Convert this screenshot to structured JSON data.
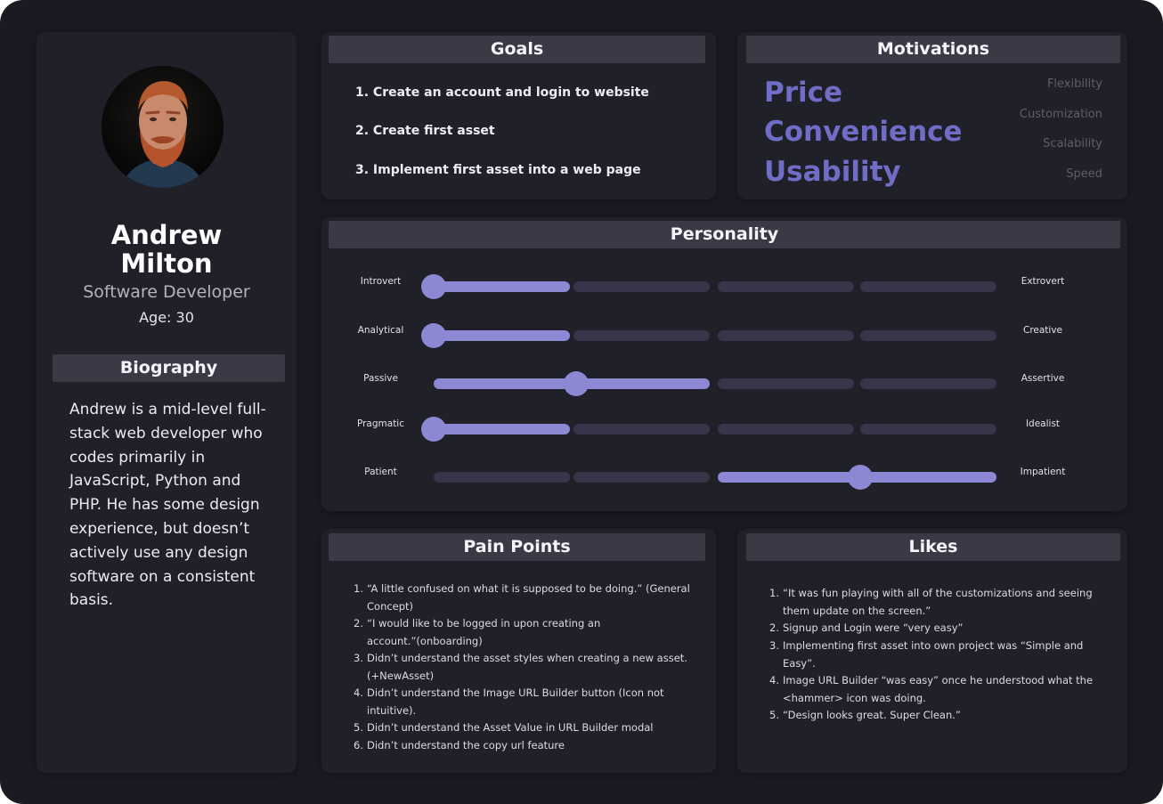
{
  "profile": {
    "name": "Andrew Milton",
    "role": "Software Developer",
    "age": "Age: 30",
    "avatar_icon": "person-portrait-icon"
  },
  "biography": {
    "title": "Biography",
    "text": "Andrew is a mid-level full-stack web developer who codes primarily in JavaScript, Python and PHP. He has some design experience, but doesn’t actively use any design software on a consistent basis."
  },
  "goals": {
    "title": "Goals",
    "items": [
      "1. Create an account and login to website",
      "2. Create first asset",
      "3. Implement first asset into a web page"
    ]
  },
  "motivations": {
    "title": "Motivations",
    "primary": [
      "Price",
      "Convenience",
      "Usability"
    ],
    "secondary": [
      "Flexibility",
      "Customization",
      "Scalability",
      "Speed"
    ]
  },
  "personality": {
    "title": "Personality",
    "traits": [
      {
        "left": "Introvert",
        "right": "Extrovert",
        "level": 0.0
      },
      {
        "left": "Analytical",
        "right": "Creative",
        "level": 0.0
      },
      {
        "left": "Passive",
        "right": "Assertive",
        "level": 0.25
      },
      {
        "left": "Pragmatic",
        "right": "Idealist",
        "level": 0.0
      },
      {
        "left": "Patient",
        "right": "Impatient",
        "level": 0.75
      }
    ]
  },
  "pain_points": {
    "title": "Pain Points",
    "items": [
      {
        "n": "1.",
        "lines": [
          "“A little confused on what it is supposed to be doing.” (General",
          "Concept)"
        ]
      },
      {
        "n": "2.",
        "lines": [
          "“I would like to be logged in upon creating an",
          "account.”(onboarding)"
        ]
      },
      {
        "n": "3.",
        "lines": [
          "Didn’t understand the asset styles when creating a new asset.",
          "(+NewAsset)"
        ]
      },
      {
        "n": "4.",
        "lines": [
          "Didn’t understand the Image URL Builder button (Icon not",
          "intuitive)."
        ]
      },
      {
        "n": "5.",
        "lines": [
          "Didn’t understand the Asset Value in URL Builder modal"
        ]
      },
      {
        "n": "6.",
        "lines": [
          "Didn’t understand the copy url feature"
        ]
      }
    ]
  },
  "likes": {
    "title": "Likes",
    "items": [
      {
        "n": "1.",
        "lines": [
          "“It was fun playing with all of the customizations and seeing",
          "them update on the screen.”"
        ]
      },
      {
        "n": "2.",
        "lines": [
          "Signup and Login were “very easy”"
        ]
      },
      {
        "n": "3.",
        "lines": [
          "Implementing first asset into own project was “Simple and",
          "Easy”."
        ]
      },
      {
        "n": "4.",
        "lines": [
          "Image URL Builder “was easy” once he understood what the",
          "<hammer> icon was doing."
        ]
      },
      {
        "n": "5.",
        "lines": [
          "“Design looks great. Super Clean.”"
        ]
      }
    ]
  },
  "colors": {
    "accent": "#8c88d4",
    "motivation_primary": "#6f6dc6",
    "track_off": "#36354a",
    "background": "#1a1a22",
    "card": "#202028",
    "header_bar": "#3a3a46"
  }
}
